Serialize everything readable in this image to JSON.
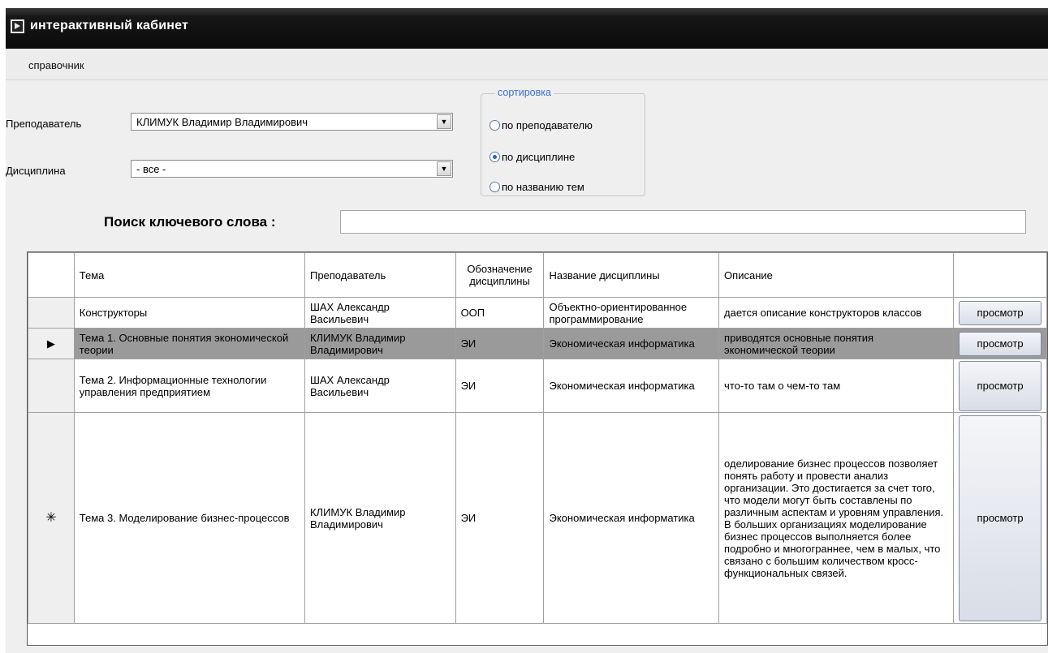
{
  "window": {
    "title": "интерактивный кабинет"
  },
  "menu": {
    "items": [
      "справочник"
    ]
  },
  "filters": {
    "teacher_label": "Преподаватель",
    "teacher_value": "КЛИМУК Владимир Владимирович",
    "discipline_label": "Дисциплина",
    "discipline_value": "- все -"
  },
  "sorting": {
    "legend": "сортировка",
    "options": [
      "по преподавателю",
      "по дисциплине",
      "по названию тем"
    ],
    "selected": "по дисциплине"
  },
  "search": {
    "label": "Поиск ключевого слова :",
    "value": ""
  },
  "table": {
    "columns": [
      "Тема",
      "Преподаватель",
      "Обозначение дисциплины",
      "Название дисциплины",
      "Описание",
      ""
    ],
    "rows": [
      {
        "marker": "",
        "topic": "Конструкторы",
        "teacher": "ШАХ Александр Васильевич",
        "code": "ООП",
        "discipline": "Объектно-ориентированное программирование",
        "description": "дается описание конструкторов классов",
        "action": "просмотр"
      },
      {
        "marker": "▶",
        "topic": "Тема 1. Основные понятия экономической теории",
        "teacher": "КЛИМУК Владимир Владимирович",
        "code": "ЭИ",
        "discipline": "Экономическая информатика",
        "description": "приводятся основные понятия экономической теории",
        "action": "просмотр"
      },
      {
        "marker": "",
        "topic": "Тема 2. Информационные технологии управления предприятием",
        "teacher": "ШАХ Александр Васильевич",
        "code": "ЭИ",
        "discipline": "Экономическая информатика",
        "description": "что-то там о чем-то там",
        "action": "просмотр"
      },
      {
        "marker": "✳",
        "topic": "Тема 3. Моделирование бизнес-процессов",
        "teacher": "КЛИМУК Владимир Владимирович",
        "code": "ЭИ",
        "discipline": "Экономическая информатика",
        "description": "оделирование бизнес процессов позволяет понять работу и провести анализ организации. Это достигается за счет того, что модели могут быть составлены по различным аспектам и уровням управления. В больших организациях моделирование бизнес процессов выполняется более подробно и многограннее, чем в малых, что связано с большим количеством кросс-функциональных связей.",
        "action": "просмотр"
      }
    ]
  }
}
